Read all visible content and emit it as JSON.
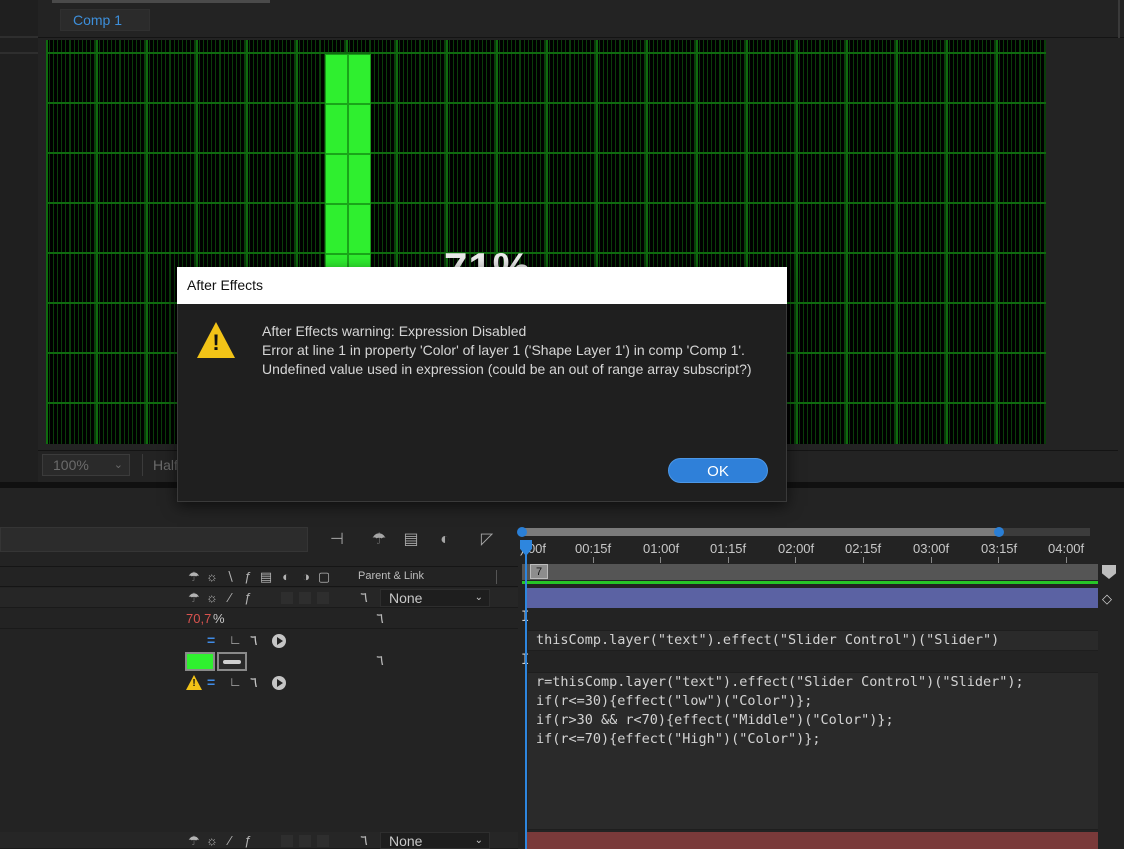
{
  "composition": {
    "tab_label": "Comp 1",
    "preview_text": "71%",
    "zoom": "100%",
    "resolution": "Half"
  },
  "timeline": {
    "ruler_labels": [
      "):00f",
      "00:15f",
      "01:00f",
      "01:15f",
      "02:00f",
      "02:15f",
      "03:00f",
      "03:15f",
      "04:00f"
    ],
    "marker": "7",
    "header_parent_label": "Parent & Link",
    "layer_parent": "None",
    "last_layer_parent": "None",
    "opacity_value": "70,7",
    "opacity_unit": "%",
    "expression_1": "thisComp.layer(\"text\").effect(\"Slider Control\")(\"Slider\")",
    "expression_2_lines": [
      "r=thisComp.layer(\"text\").effect(\"Slider Control\")(\"Slider\");",
      "if(r<=30){effect(\"low\")(\"Color\")};",
      "if(r>30 && r<70){effect(\"Middle\")(\"Color\")};",
      "if(r<=70){effect(\"High\")(\"Color\")};"
    ],
    "layer_bar_color": "#5b62a3",
    "last_layer_bar_color": "#7a3a3a",
    "swatch_color": "#2ff02f"
  },
  "dialog": {
    "title": "After Effects",
    "message_lines": [
      "After Effects warning: Expression Disabled",
      "Error at line 1 in property 'Color' of layer 1 ('Shape Layer 1') in comp 'Comp 1'.",
      "Undefined value used in expression (could be an out of range array subscript?)"
    ],
    "ok_label": "OK",
    "icon": "warning-icon"
  }
}
